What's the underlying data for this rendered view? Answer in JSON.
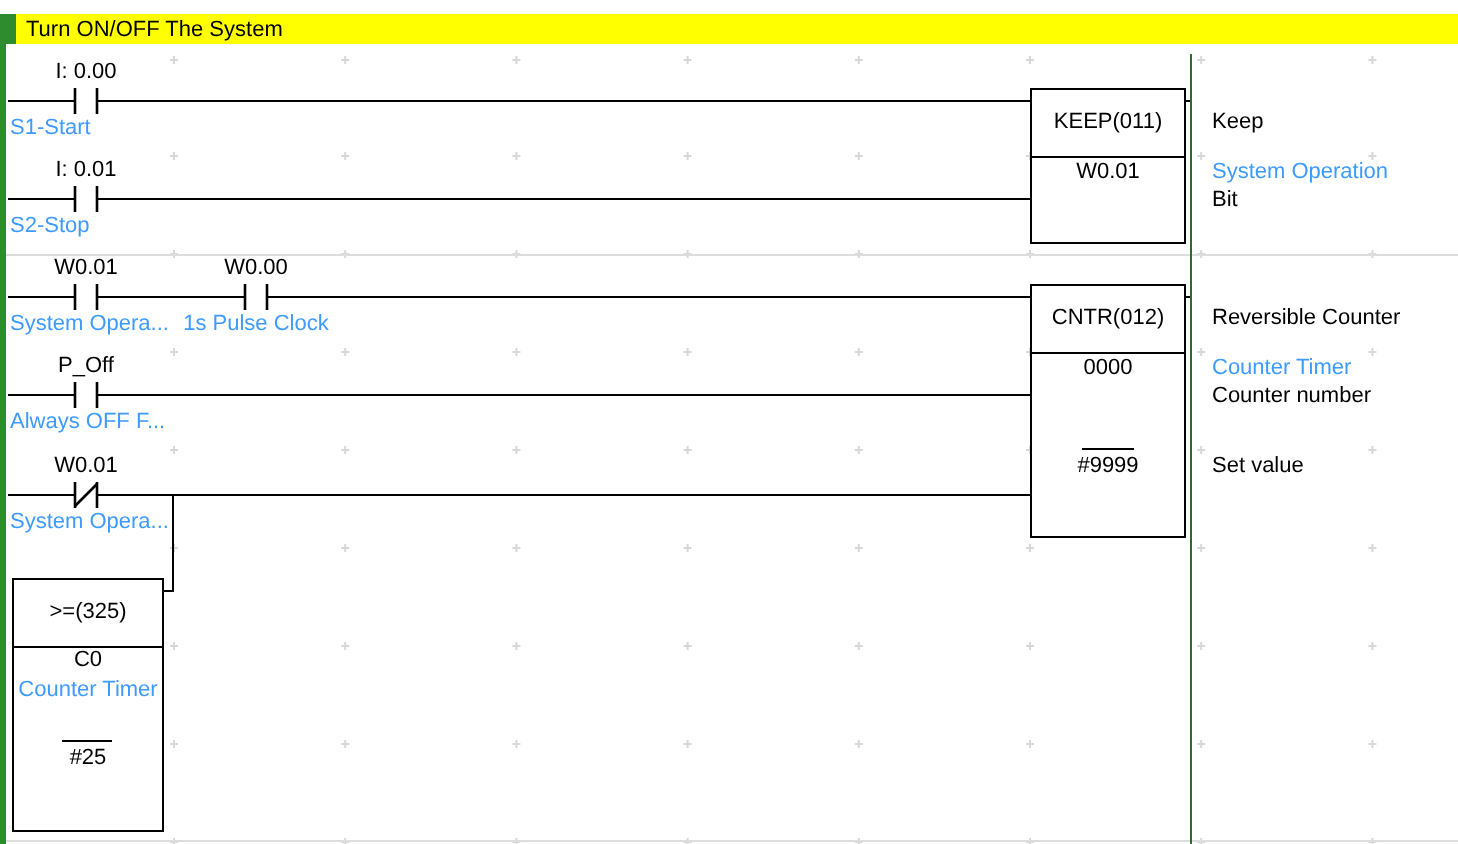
{
  "title": "Turn ON/OFF The System",
  "rungs": [
    {
      "contacts": [
        {
          "kind": "no",
          "address": "I: 0.00",
          "comment": "S1-Start"
        },
        {
          "kind": "no",
          "address": "I: 0.01",
          "comment": "S2-Stop"
        }
      ],
      "block": {
        "mnemonic": "KEEP(011)",
        "operands": [
          {
            "kind": "plain",
            "value": "W0.01"
          }
        ]
      },
      "notes": [
        {
          "kind": "plain",
          "text": "Keep"
        },
        {
          "kind": "comment",
          "text": "System Operation"
        },
        {
          "kind": "plain",
          "text": "Bit"
        }
      ]
    },
    {
      "contacts": [
        {
          "kind": "no",
          "address": "W0.01",
          "comment": "System Opera..."
        },
        {
          "kind": "no",
          "address": "W0.00",
          "comment": "1s Pulse Clock"
        },
        {
          "kind": "no",
          "address": "P_Off",
          "comment": "Always OFF F..."
        },
        {
          "kind": "nc",
          "address": "W0.01",
          "comment": "System Opera..."
        }
      ],
      "block": {
        "mnemonic": "CNTR(012)",
        "operands": [
          {
            "kind": "plain",
            "value": "0000"
          },
          {
            "kind": "constant",
            "value": "#9999"
          }
        ]
      },
      "notes": [
        {
          "kind": "plain",
          "text": "Reversible Counter"
        },
        {
          "kind": "comment",
          "text": "Counter Timer"
        },
        {
          "kind": "plain",
          "text": "Counter number"
        },
        {
          "kind": "plain",
          "text": "Set value"
        }
      ],
      "compare": {
        "mnemonic": ">=(325)",
        "operands": [
          {
            "kind": "plain",
            "value": "C0",
            "comment": "Counter Timer"
          },
          {
            "kind": "constant",
            "value": "#25"
          }
        ]
      }
    }
  ]
}
